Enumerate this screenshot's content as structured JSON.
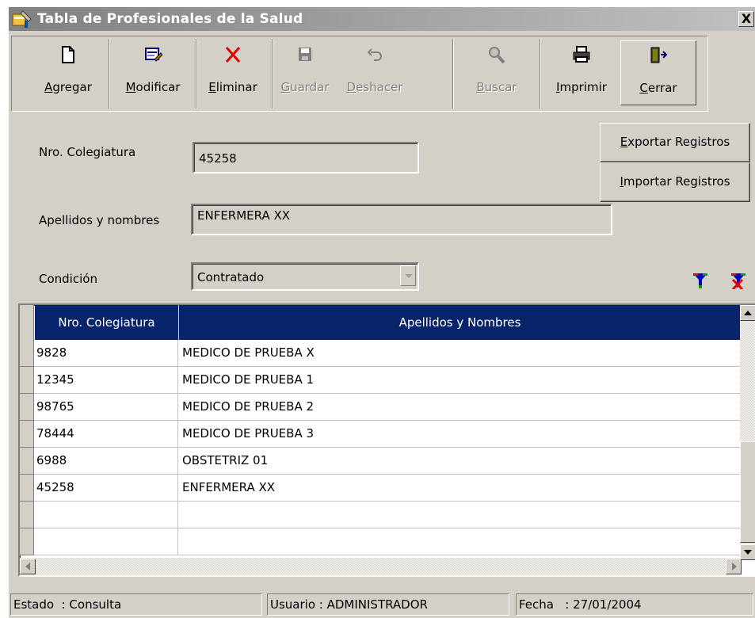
{
  "window": {
    "title": "Tabla de Profesionales de la Salud",
    "close_label": "X"
  },
  "toolbar": {
    "buttons": [
      {
        "label_u": "A",
        "label_rest": "gregar",
        "icon": "new-document-icon",
        "enabled": true
      },
      {
        "label_u": "M",
        "label_rest": "odificar",
        "icon": "edit-form-icon",
        "enabled": true
      },
      {
        "label_u": "E",
        "label_rest": "liminar",
        "icon": "delete-x-icon",
        "enabled": true
      },
      {
        "label_u": "G",
        "label_rest": "uardar",
        "icon": "save-disk-icon",
        "enabled": false
      },
      {
        "label_u": "D",
        "label_rest": "eshacer",
        "icon": "undo-icon",
        "enabled": false
      },
      {
        "label_u": "B",
        "label_rest": "uscar",
        "icon": "search-icon",
        "enabled": false
      },
      {
        "label_u": "I",
        "label_rest": "mprimir",
        "icon": "printer-icon",
        "enabled": true
      },
      {
        "label_u": "C",
        "label_rest": "errar",
        "icon": "exit-door-icon",
        "enabled": true
      }
    ]
  },
  "form": {
    "colegiatura_label": "Nro. Colegiatura",
    "colegiatura_value": "45258",
    "nombres_label": "Apellidos y nombres",
    "nombres_value": "ENFERMERA XX",
    "condicion_label": "Condición",
    "condicion_value": "Contratado",
    "export_u": "E",
    "export_rest": "xportar Registros",
    "import_u": "I",
    "import_rest": "mportar Registros"
  },
  "grid": {
    "columns": [
      "Nro. Colegiatura",
      "Apellidos y Nombres"
    ],
    "rows": [
      {
        "nro": "9828",
        "nombre": "MEDICO DE PRUEBA X"
      },
      {
        "nro": "12345",
        "nombre": "MEDICO DE PRUEBA 1"
      },
      {
        "nro": "98765",
        "nombre": "MEDICO DE PRUEBA 2"
      },
      {
        "nro": "78444",
        "nombre": "MEDICO DE PRUEBA 3"
      },
      {
        "nro": "6988",
        "nombre": "OBSTETRIZ 01"
      },
      {
        "nro": "45258",
        "nombre": "ENFERMERA XX"
      },
      {
        "nro": "",
        "nombre": ""
      },
      {
        "nro": "",
        "nombre": ""
      }
    ]
  },
  "status": {
    "estado": "Estado  : Consulta",
    "usuario": "Usuario : ADMINISTRADOR",
    "fecha": "Fecha   : 27/01/2004"
  },
  "colors": {
    "face": "#d4d0c8",
    "header_bg": "#08246b",
    "titlebar": "#808080"
  }
}
